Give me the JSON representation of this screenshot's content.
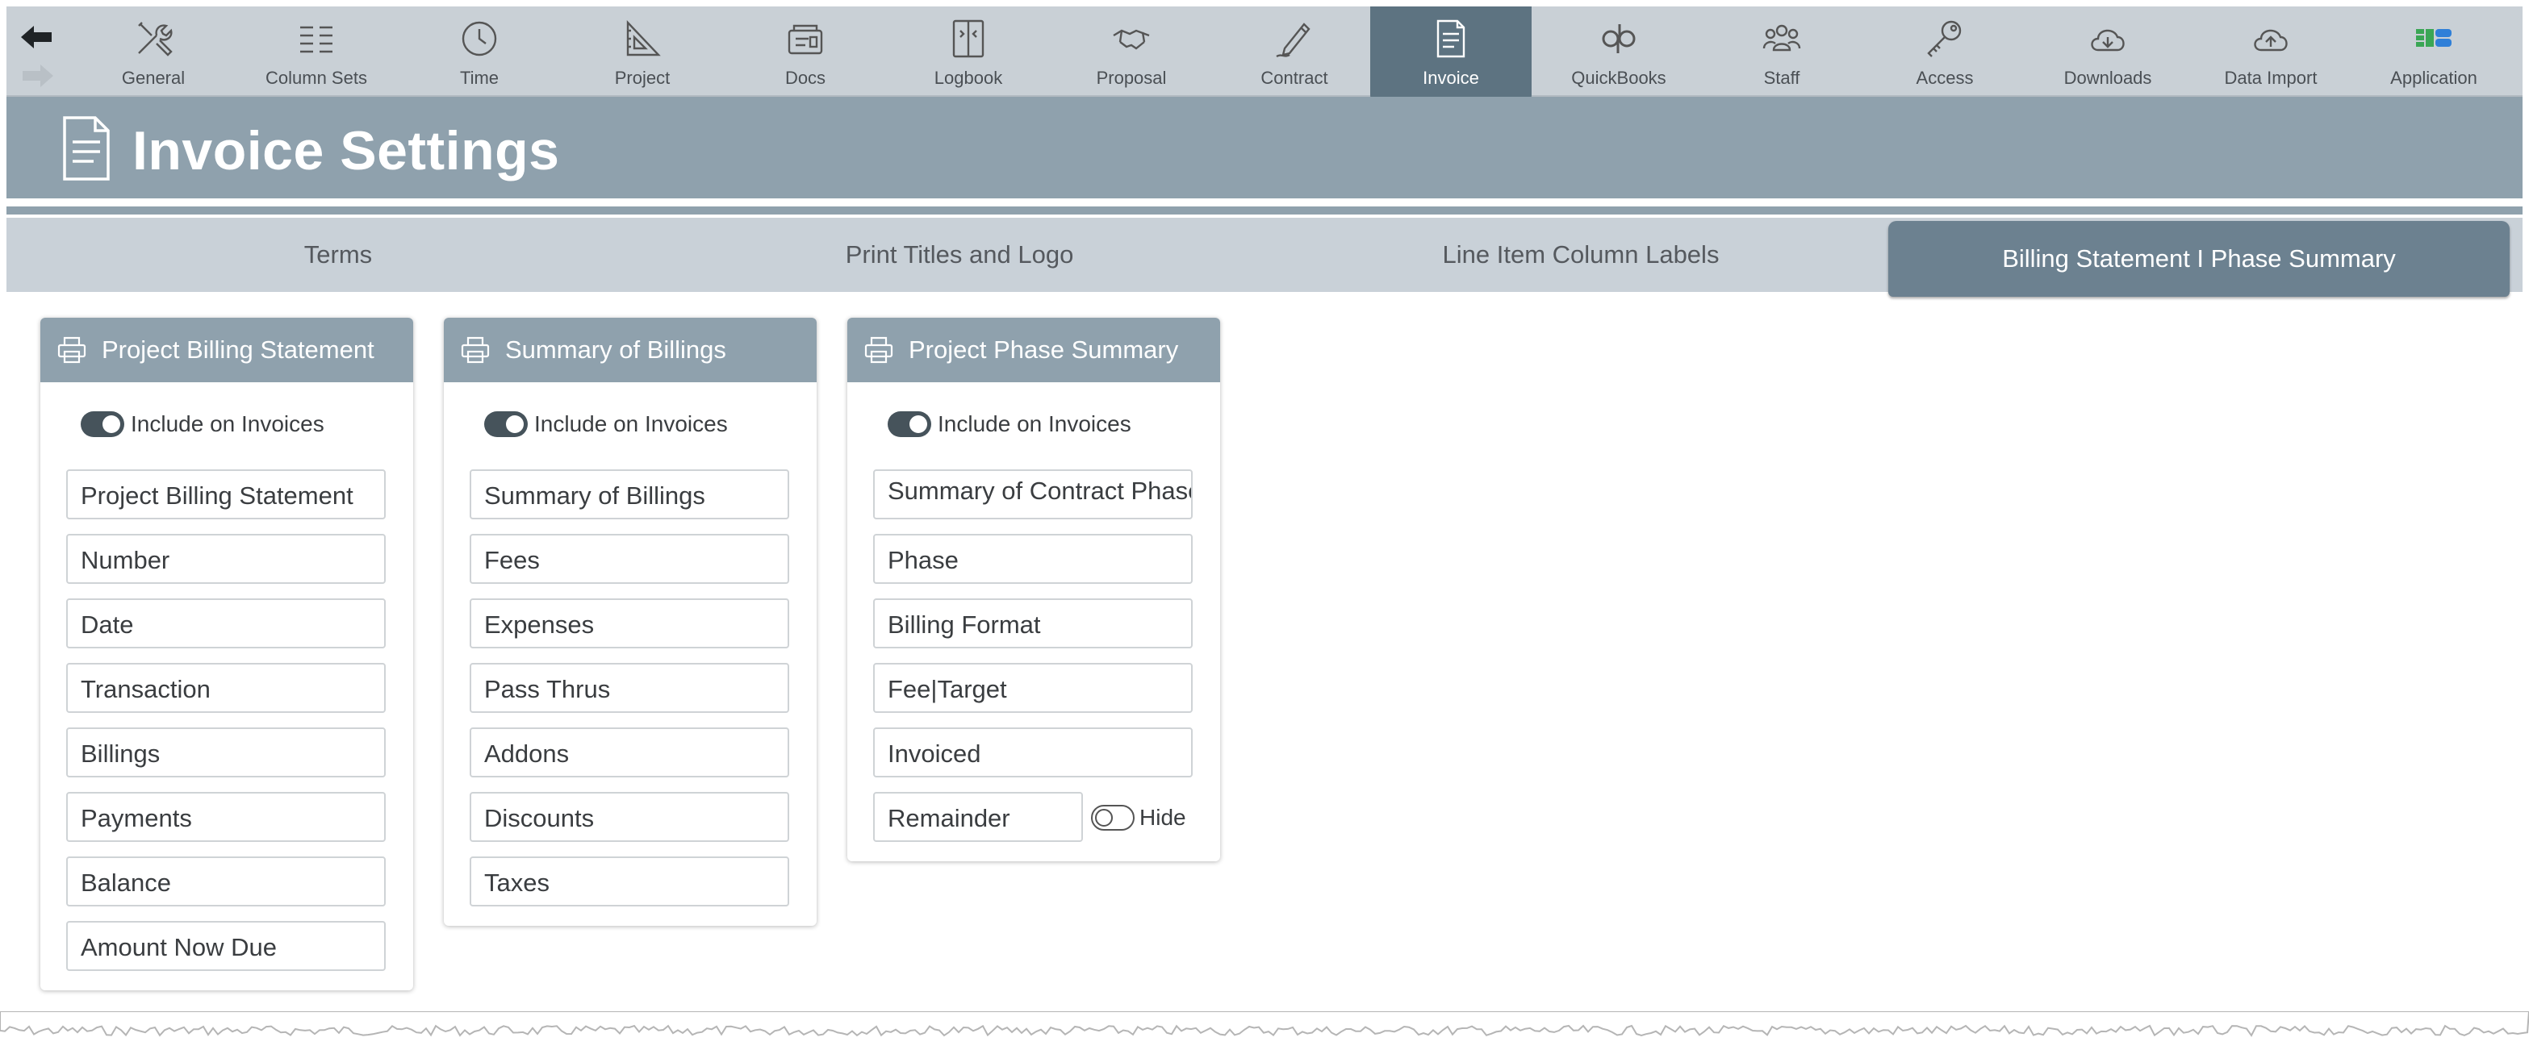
{
  "toolbar": {
    "items": [
      {
        "label": "General",
        "icon": "tools-icon"
      },
      {
        "label": "Column Sets",
        "icon": "columns-icon"
      },
      {
        "label": "Time",
        "icon": "clock-icon"
      },
      {
        "label": "Project",
        "icon": "drafting-triangle-icon"
      },
      {
        "label": "Docs",
        "icon": "docs-icon"
      },
      {
        "label": "Logbook",
        "icon": "logbook-icon"
      },
      {
        "label": "Proposal",
        "icon": "handshake-icon"
      },
      {
        "label": "Contract",
        "icon": "pen-icon"
      },
      {
        "label": "Invoice",
        "icon": "invoice-icon"
      },
      {
        "label": "QuickBooks",
        "icon": "quickbooks-icon"
      },
      {
        "label": "Staff",
        "icon": "staff-icon"
      },
      {
        "label": "Access",
        "icon": "key-icon"
      },
      {
        "label": "Downloads",
        "icon": "cloud-download-icon"
      },
      {
        "label": "Data Import",
        "icon": "cloud-upload-icon"
      },
      {
        "label": "Application",
        "icon": "application-logo-icon"
      }
    ],
    "active": "Invoice"
  },
  "header": {
    "title": "Invoice Settings"
  },
  "tabs": [
    {
      "label": "Terms"
    },
    {
      "label": "Print Titles and Logo"
    },
    {
      "label": "Line Item Column Labels"
    },
    {
      "label": "Billing Statement I Phase Summary"
    }
  ],
  "cards": [
    {
      "title": "Project Billing Statement",
      "toggle_label": "Include on Invoices",
      "fields": [
        "Project Billing Statement",
        "Number",
        "Date",
        "Transaction",
        "Billings",
        "Payments",
        "Balance",
        "Amount Now Due"
      ]
    },
    {
      "title": "Summary of Billings",
      "toggle_label": "Include on Invoices",
      "fields": [
        "Summary of Billings",
        "Fees",
        "Expenses",
        "Pass Thrus",
        "Addons",
        "Discounts",
        "Taxes"
      ]
    },
    {
      "title": "Project Phase Summary",
      "toggle_label": "Include on Invoices",
      "fields": [
        "Summary of Contract Phases",
        "Phase",
        "Billing Format",
        "Fee|Target",
        "Invoiced",
        "Remainder"
      ],
      "hide_label": "Hide"
    }
  ],
  "colors": {
    "toolbar": "#c9d0d6",
    "header": "#8fa1ad",
    "active_tab": "#6c8190",
    "active_nav": "#5d7381",
    "toggle_on": "#46535b"
  }
}
